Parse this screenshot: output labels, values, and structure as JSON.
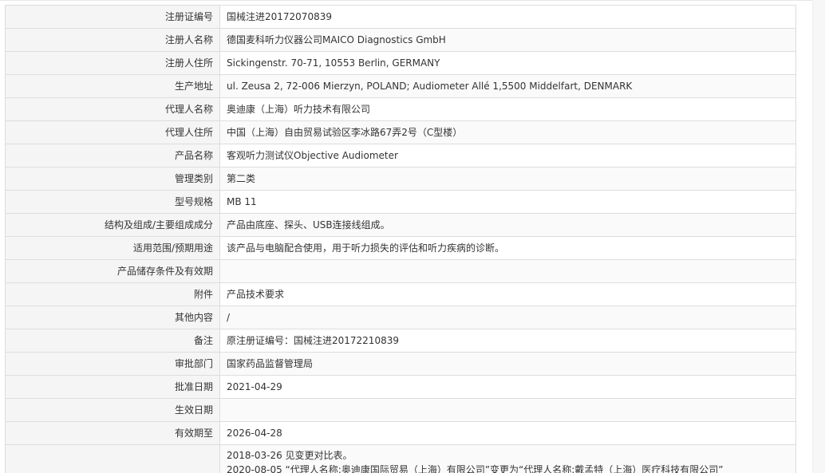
{
  "rows": [
    {
      "label": "注册证编号",
      "value": "国械注进20172070839"
    },
    {
      "label": "注册人名称",
      "value": "德国麦科听力仪器公司MAICO Diagnostics GmbH"
    },
    {
      "label": "注册人住所",
      "value": "Sickingenstr. 70-71, 10553 Berlin, GERMANY"
    },
    {
      "label": "生产地址",
      "value": "ul. Zeusa 2, 72-006 Mierzyn, POLAND; Audiometer Allé 1,5500 Middelfart, DENMARK"
    },
    {
      "label": "代理人名称",
      "value": "奥迪康（上海）听力技术有限公司"
    },
    {
      "label": "代理人住所",
      "value": "中国（上海）自由贸易试验区李冰路67弄2号（C型楼）"
    },
    {
      "label": "产品名称",
      "value": "客观听力测试仪Objective Audiometer"
    },
    {
      "label": "管理类别",
      "value": "第二类"
    },
    {
      "label": "型号规格",
      "value": "MB 11"
    },
    {
      "label": "结构及组成/主要组成成分",
      "value": "产品由底座、探头、USB连接线组成。"
    },
    {
      "label": "适用范围/预期用途",
      "value": "该产品与电脑配合使用，用于听力损失的评估和听力疾病的诊断。"
    },
    {
      "label": "产品储存条件及有效期",
      "value": ""
    },
    {
      "label": "附件",
      "value": "产品技术要求"
    },
    {
      "label": "其他内容",
      "value": "/"
    },
    {
      "label": "备注",
      "value": "原注册证编号：国械注进20172210839"
    },
    {
      "label": "审批部门",
      "value": "国家药品监督管理局"
    },
    {
      "label": "批准日期",
      "value": "2021-04-29"
    },
    {
      "label": "生效日期",
      "value": ""
    },
    {
      "label": "有效期至",
      "value": "2026-04-28"
    }
  ],
  "change_history": {
    "label": "",
    "lines": [
      "2018-03-26 见变更对比表。",
      "2020-08-05 “代理人名称:奥迪康国际贸易（上海）有限公司”变更为“代理人名称:戴孟特（上海）医疗科技有限公司”"
    ]
  }
}
